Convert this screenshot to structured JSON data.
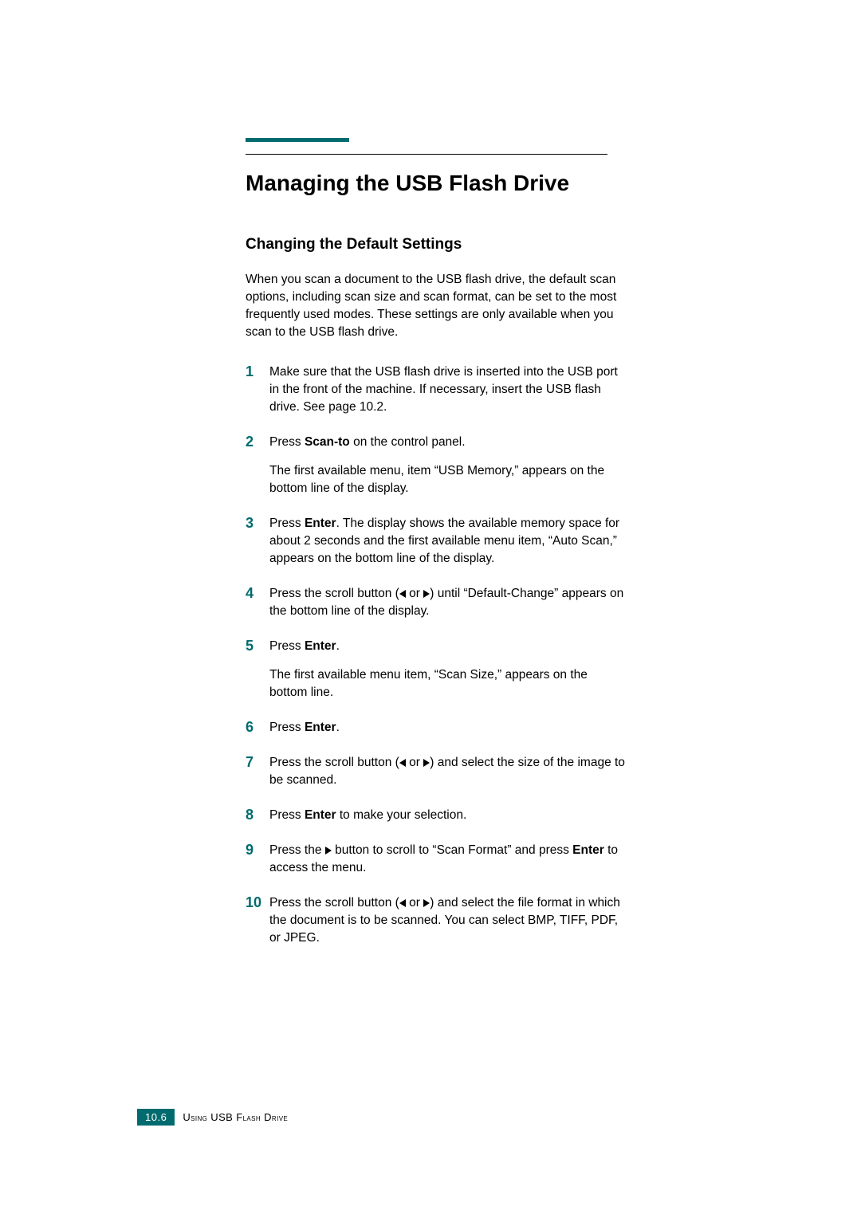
{
  "heading": "Managing the USB Flash Drive",
  "subheading": "Changing the Default Settings",
  "intro": "When you scan a document to the USB flash drive, the default scan options, including scan size and scan format, can be set to the most frequently used modes. These settings are only available when you scan to the USB flash drive.",
  "steps": {
    "s1": "Make sure that the USB flash drive is inserted into the USB port in the front of the machine. If necessary, insert the USB flash drive. See page 10.2.",
    "s2_a": "Press ",
    "s2_b": "Scan-to",
    "s2_c": " on the control panel.",
    "s2_p": "The first available menu, item “USB Memory,” appears on the bottom line of the display.",
    "s3_a": "Press ",
    "s3_b": "Enter",
    "s3_c": ". The display shows the available memory space for about 2 seconds and the first available menu item, “Auto Scan,” appears on the bottom line of the display.",
    "s4_a": "Press the scroll button (",
    "s4_mid": " or ",
    "s4_b": ") until “Default-Change” appears on the bottom line of the display.",
    "s5_a": "Press ",
    "s5_b": "Enter",
    "s5_c": ".",
    "s5_p": "The first available menu item, “Scan Size,” appears on the bottom line.",
    "s6_a": "Press ",
    "s6_b": "Enter",
    "s6_c": ".",
    "s7_a": "Press the scroll button (",
    "s7_mid": " or ",
    "s7_b": ") and select the size of the image to be scanned.",
    "s8_a": "Press ",
    "s8_b": "Enter",
    "s8_c": " to make your selection.",
    "s9_a": "Press the ",
    "s9_b": " button to scroll to “Scan Format” and press ",
    "s9_c": "Enter",
    "s9_d": " to access the menu.",
    "s10_a": "Press the scroll button (",
    "s10_mid": " or ",
    "s10_b": ") and select the file format in which the document is to be scanned. You can select BMP, TIFF, PDF, or JPEG."
  },
  "footer": {
    "page": "10.6",
    "section_a": "U",
    "section_b": "sing",
    "section_c": " USB F",
    "section_d": "lash",
    "section_e": " D",
    "section_f": "rive"
  }
}
